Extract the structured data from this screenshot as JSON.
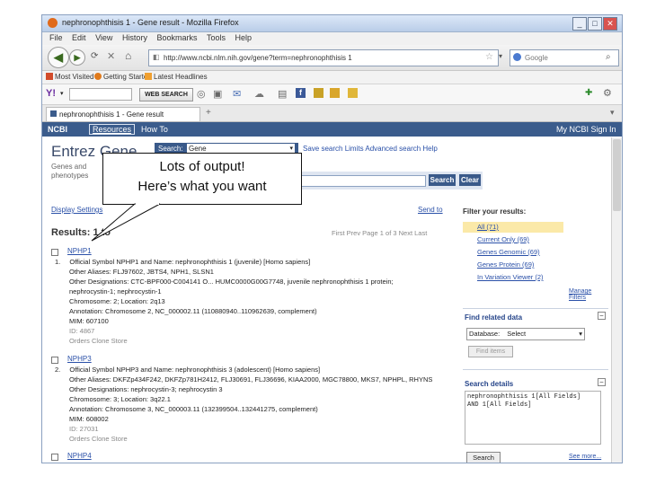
{
  "window": {
    "title": "nephronophthisis 1 - Gene result - Mozilla Firefox",
    "buttons": [
      "_",
      "□",
      "✕"
    ]
  },
  "menu": [
    "File",
    "Edit",
    "View",
    "History",
    "Bookmarks",
    "Tools",
    "Help"
  ],
  "nav": {
    "url": "http://www.ncbi.nlm.nih.gov/gene?term=nephronophthisis 1",
    "search_placeholder": "Google"
  },
  "bookmarks": [
    "Most Visited",
    "Getting Started",
    "Latest Headlines"
  ],
  "addons": {
    "mcafee": "McAfee",
    "websearch": "WEB SEARCH"
  },
  "tab": {
    "label": "nephronophthisis 1 - Gene result"
  },
  "ncbi": {
    "left": "NCBI",
    "resources": "Resources",
    "howto": "How To",
    "signin": "My NCBI Sign In"
  },
  "entrez": {
    "title": "Entrez Gene",
    "search_label": "Search:",
    "search_db": "Gene",
    "links": "Save search  Limits  Advanced search  Help",
    "search_button": "Search",
    "clear_button": "Clear",
    "desc1": "Genes and",
    "desc2": "phenotypes"
  },
  "results": {
    "display": "Display Settings",
    "sendto": "Send to",
    "heading": "Results: 1 to",
    "pager": "First  Prev  Page 1 of 3  Next  Last"
  },
  "records": [
    {
      "link": "NPHP1",
      "num": "1.",
      "symbol_line": "Official Symbol NPHP1 and Name: nephronophthisis 1 (juvenile) [Homo sapiens]",
      "aliases": "Other Aliases: FLJ97602, JBTS4, NPH1, SLSN1",
      "designations": "Other Designations: CTC-BPF000-C004141 O... HUMC0000G00G7748, juvenile nephronophthisis 1 protein;",
      "designations2": "nephrocystin-1; nephrocystin-1",
      "chromosome": "Chromosome: 2; Location: 2q13",
      "annotation": "Annotation: Chromosome 2, NC_000002.11 (110880940..110962639, complement)",
      "mim": "MIM: 607100",
      "id": "ID: 4867",
      "orders": "Orders Clone Store"
    },
    {
      "link": "NPHP3",
      "num": "2.",
      "symbol_line": "Official Symbol NPHP3 and Name: nephronophthisis 3 (adolescent) [Homo sapiens]",
      "aliases": "Other Aliases: DKFZp434F242, DKFZp781H2412, FLJ30691, FLJ36696, KIAA2000, MGC78800, MKS7, NPHPL, RHYNS",
      "designations": "Other Designations: nephrocystin-3; nephrocystin 3",
      "chromosome": "Chromosome: 3; Location: 3q22.1",
      "annotation": "Annotation: Chromosome 3, NC_000003.11 (132399504..132441275, complement)",
      "mim": "MIM: 608002",
      "id": "ID: 27031",
      "orders": "Orders Clone Store"
    },
    {
      "link": "NPHP4",
      "num": "3."
    }
  ],
  "sidebar": {
    "filter_title": "Filter your results:",
    "filters": [
      "All (71)",
      "Current Only (69)",
      "Genes Genomic (69)",
      "Genes Protein (69)",
      "In Variation Viewer (2)"
    ],
    "manage": "Manage Filters",
    "related_title": "Find related data",
    "database_label": "Database:",
    "database_value": "Select",
    "find_items": "Find items",
    "details_title": "Search details",
    "details_text1": "nephronophthisis 1[All Fields]",
    "details_text2": "AND 1[All Fields]",
    "search_button": "Search",
    "see_more": "See more..."
  },
  "callout": {
    "line1": "Lots of output!",
    "line2": "Here’s what you want"
  }
}
